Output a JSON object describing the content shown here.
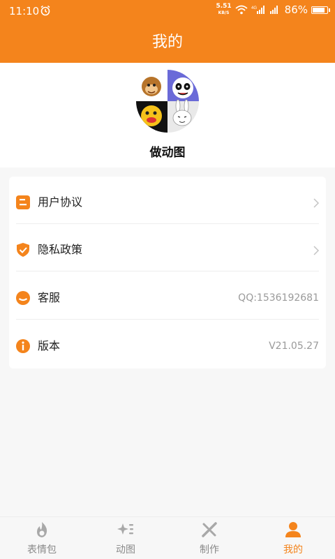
{
  "status_bar": {
    "time": "11:10",
    "net_speed": "5.51",
    "net_unit": "KB/S",
    "battery": "86%"
  },
  "header": {
    "title": "我的"
  },
  "profile": {
    "name": "做动图"
  },
  "menu": {
    "items": [
      {
        "label": "用户协议",
        "value": "",
        "icon": "document-icon"
      },
      {
        "label": "隐私政策",
        "value": "",
        "icon": "shield-icon"
      },
      {
        "label": "客服",
        "value": "QQ:1536192681",
        "icon": "support-icon"
      },
      {
        "label": "版本",
        "value": "V21.05.27",
        "icon": "info-icon"
      }
    ]
  },
  "tabs": [
    {
      "label": "表情包",
      "icon": "flame-icon",
      "active": false
    },
    {
      "label": "动图",
      "icon": "sparkle-icon",
      "active": false
    },
    {
      "label": "制作",
      "icon": "tools-icon",
      "active": false
    },
    {
      "label": "我的",
      "icon": "person-icon",
      "active": true
    }
  ],
  "colors": {
    "accent": "#f4841c",
    "background": "#f7f7f7"
  }
}
